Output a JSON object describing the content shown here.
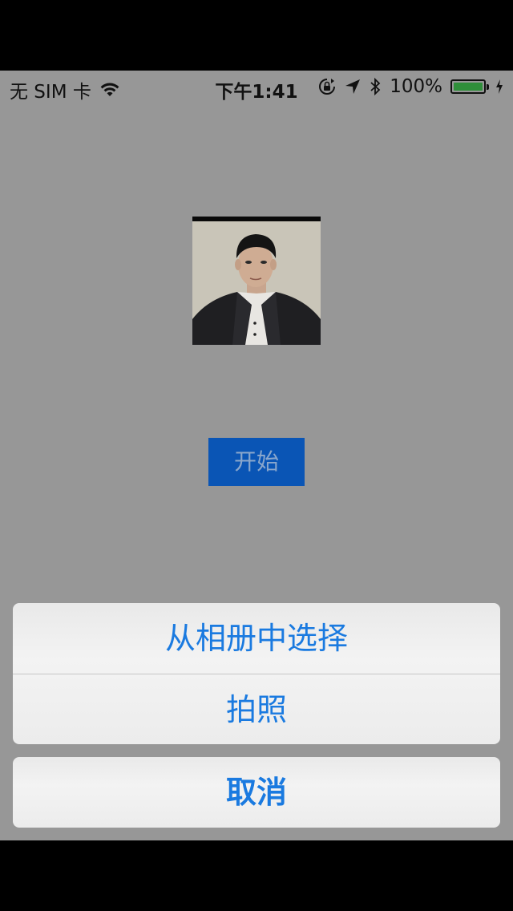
{
  "status_bar": {
    "carrier": "无 SIM 卡",
    "time": "下午1:41",
    "battery_percent_label": "100%",
    "battery_level": 1.0,
    "icons": [
      "wifi-icon",
      "rotation-lock-icon",
      "location-arrow-icon",
      "bluetooth-icon",
      "battery-icon",
      "charging-bolt-icon"
    ]
  },
  "main": {
    "start_button_label": "开始"
  },
  "action_sheet": {
    "items": [
      {
        "label": "从相册中选择"
      },
      {
        "label": "拍照"
      }
    ],
    "cancel_label": "取消"
  },
  "colors": {
    "overlay_background": "#979797",
    "start_button_bg": "#0a55b5",
    "action_text": "#1a7ae0",
    "battery_green": "#2f8f3a"
  }
}
